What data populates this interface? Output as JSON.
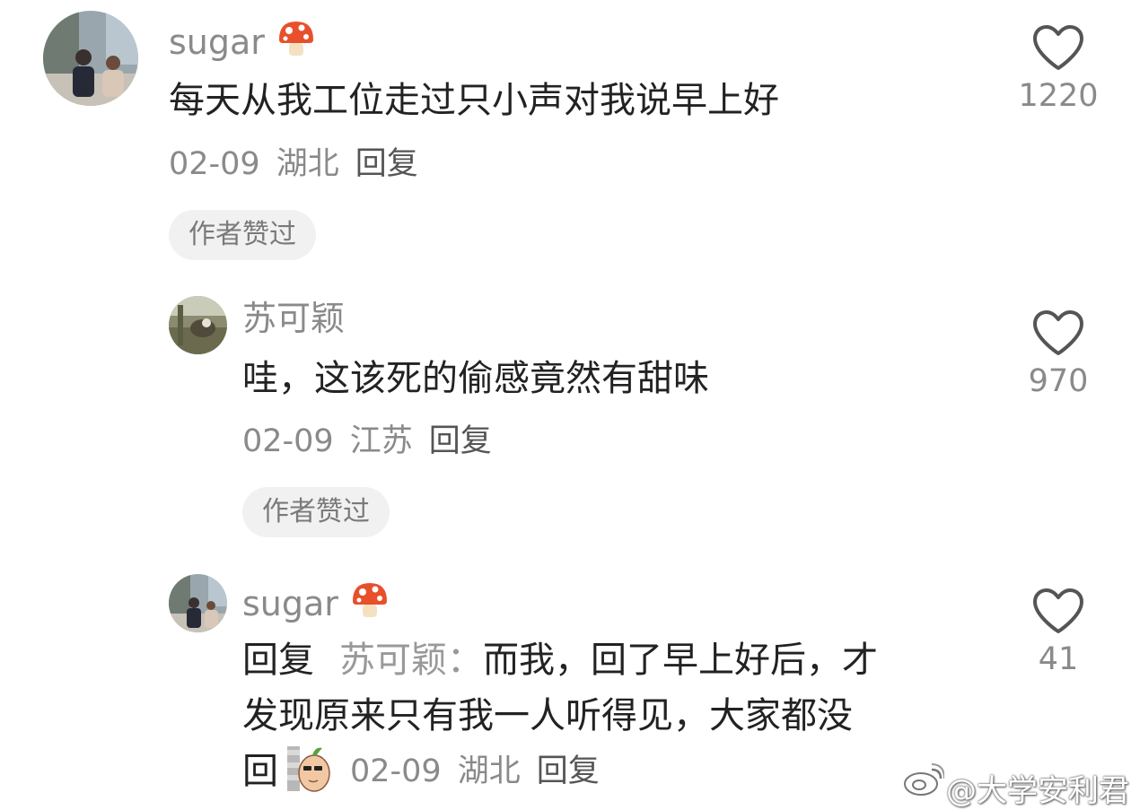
{
  "comments": [
    {
      "username": "sugar",
      "username_badge": "mushroom-icon",
      "text": "每天从我工位走过只小声对我说早上好",
      "date": "02-09",
      "location": "湖北",
      "reply_label": "回复",
      "author_liked_chip": "作者赞过",
      "like_count": "1220"
    },
    {
      "username": "苏可颖",
      "text": "哇，这该死的偷感竟然有甜味",
      "date": "02-09",
      "location": "江苏",
      "reply_label": "回复",
      "author_liked_chip": "作者赞过",
      "like_count": "970"
    },
    {
      "username": "sugar",
      "username_badge": "mushroom-icon",
      "reply_prefix": "回复",
      "reply_to": "苏可颖",
      "reply_colon": "：",
      "text_line1": "而我，回了早上好后，才",
      "text_line2": "发现原来只有我一人听得见，大家都没",
      "text_line3": "回",
      "sticker": "peeking-peanut-sticker",
      "date": "02-09",
      "location": "湖北",
      "reply_label": "回复",
      "like_count": "41"
    }
  ],
  "watermark": "@大学安利君",
  "colors": {
    "meta_gray": "#8a8a8a",
    "text_dark": "#222222",
    "chip_bg": "#f1f1f1",
    "mushroom_red": "#e8502b"
  }
}
